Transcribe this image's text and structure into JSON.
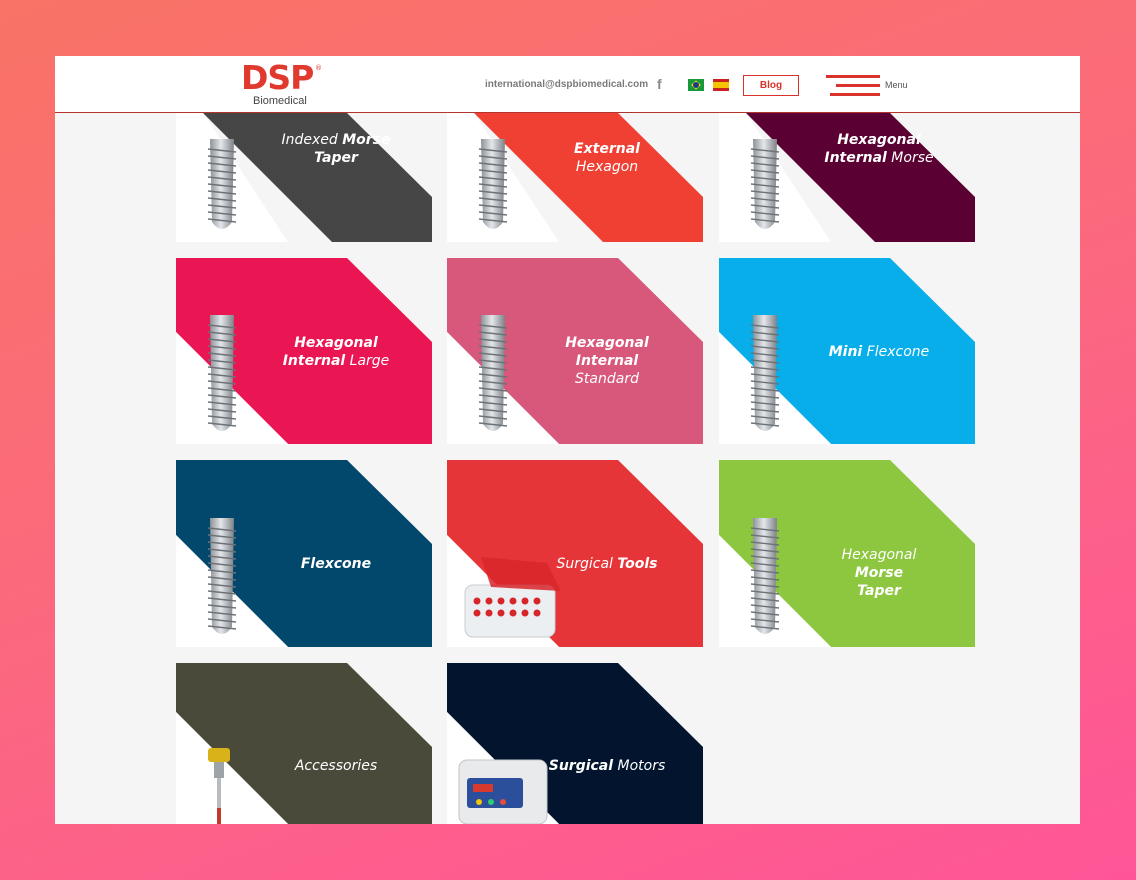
{
  "header": {
    "logo_text": "DSP",
    "logo_sub": "Biomedical",
    "logo_reg": "®",
    "email": "international@dspbiomedical.com",
    "facebook_glyph": "f",
    "flags": [
      "brazil-flag",
      "spain-flag"
    ],
    "blog_label": "Blog",
    "menu_label": "Menu"
  },
  "colors": {
    "brand": "#e0392e",
    "background": "#f5f5f5"
  },
  "cards": [
    {
      "t1": "Indexed ",
      "t2": "Morse",
      "t3": "",
      "t4": "Taper",
      "t5": "",
      "color": "#464646",
      "image": "implant-icon"
    },
    {
      "t1": "",
      "t2": "External",
      "t3": " Hexagon",
      "t4": "",
      "t5": "",
      "color": "#ef4033",
      "image": "implant-icon"
    },
    {
      "t1": "",
      "t2": "Hexagonal",
      "t3": "",
      "t4": "Internal",
      "t5": " Morse",
      "color": "#5a0032",
      "image": "implant-icon"
    },
    {
      "t1": "",
      "t2": "Hexagonal",
      "t3": "",
      "t4": "Internal",
      "t5": " Large",
      "color": "#ea1553",
      "image": "implant-icon"
    },
    {
      "t1": "",
      "t2": "Hexagonal",
      "t3": "",
      "t4": "Internal",
      "t5": " Standard",
      "color": "#d8587b",
      "image": "implant-icon"
    },
    {
      "t1": "",
      "t2": "Mini",
      "t3": " Flexcone",
      "t4": "",
      "t5": "",
      "color": "#08aeea",
      "image": "implant-icon"
    },
    {
      "t1": "",
      "t2": "Flexcone",
      "t3": "",
      "t4": "",
      "t5": "",
      "color": "#02486d",
      "image": "implant-icon"
    },
    {
      "t1": "Surgical ",
      "t2": "Tools",
      "t3": "",
      "t4": "",
      "t5": "",
      "color": "#e63538",
      "image": "surgical-kit-icon"
    },
    {
      "t1": "Hexagonal ",
      "t2": "Morse",
      "t3": "",
      "t4": "Taper",
      "t5": "",
      "color": "#8dc63f",
      "image": "implant-icon"
    },
    {
      "t1": "Accessories",
      "t2": "",
      "t3": "",
      "t4": "",
      "t5": "",
      "color": "#4a4a3b",
      "image": "screw-icon"
    },
    {
      "t1": "",
      "t2": "Surgical",
      "t3": " Motors",
      "t4": "",
      "t5": "",
      "color": "#03152e",
      "image": "surgical-motor-icon"
    }
  ]
}
